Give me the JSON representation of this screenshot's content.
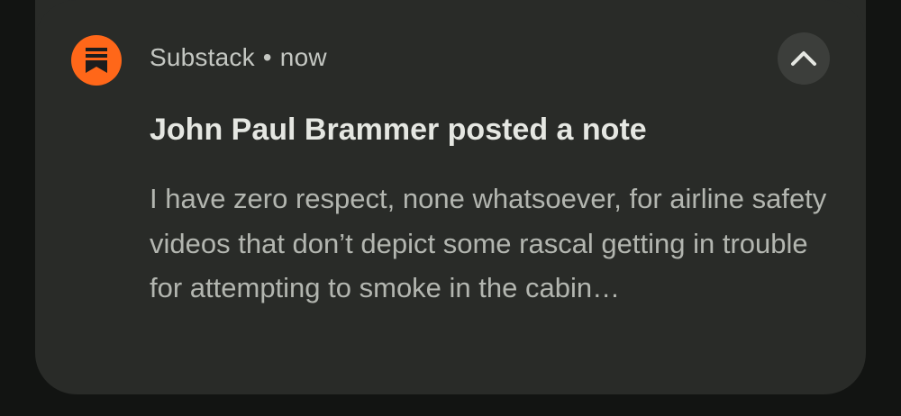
{
  "notification": {
    "app_icon": "substack-logo-icon",
    "app_name": "Substack",
    "separator": "•",
    "time": "now",
    "expand_icon": "chevron-up-icon",
    "title": "John Paul Brammer posted a note",
    "body": "I have zero respect, none whatsoever, for airline safety videos that don’t depict some rascal getting in trouble for attempting to smoke in the cabin…"
  },
  "colors": {
    "background": "#121412",
    "card": "#292b28",
    "accent": "#ff6719",
    "title_text": "#e5e7e2",
    "body_text": "#b3b6b0",
    "button": "#3c3e3b"
  }
}
